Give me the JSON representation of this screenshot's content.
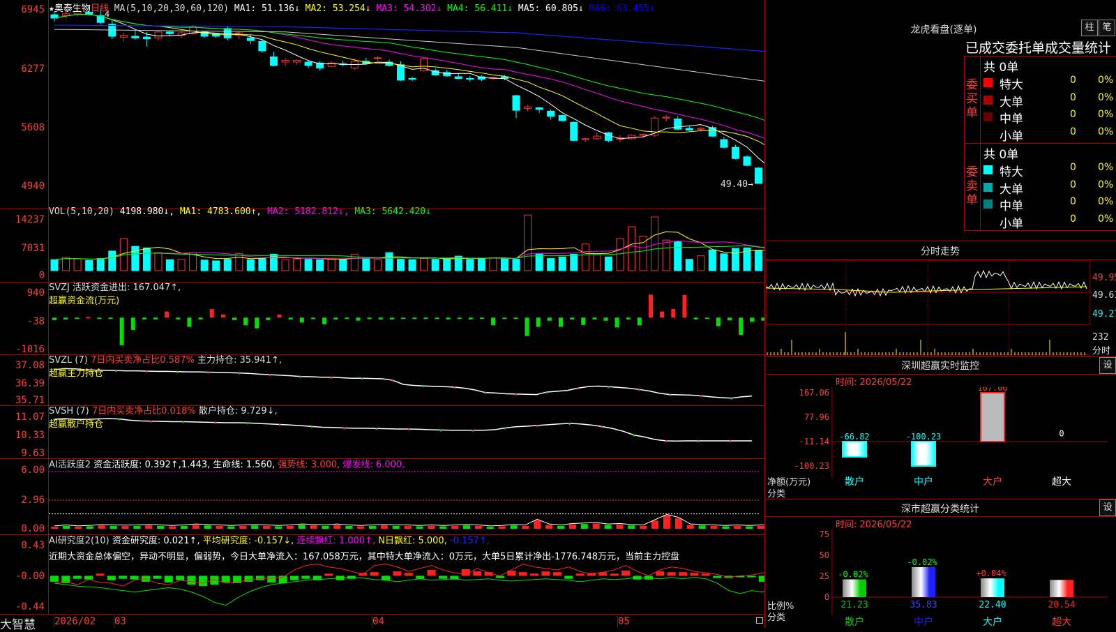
{
  "stock": {
    "name": "奥泰生物",
    "star": "★",
    "period": "日线"
  },
  "ma_line": {
    "label": "MA(5,10,20,30,60,120)",
    "items": [
      {
        "label": "MA1: 51.136↓",
        "color": "#ffffff"
      },
      {
        "label": "MA2: 53.254↓",
        "color": "#ffff00"
      },
      {
        "label": "MA3: 54.302↓",
        "color": "#ff00ff"
      },
      {
        "label": "MA4: 56.411↓",
        "color": "#00ff00"
      },
      {
        "label": "MA5: 60.805↓",
        "color": "#ffffff"
      },
      {
        "label": "MA6: 63.455↓",
        "color": "#0000ff"
      }
    ]
  },
  "price_axis": [
    "6945",
    "6277",
    "5608",
    "4940"
  ],
  "price_last_label": "49.40→",
  "price_top_marker": "4",
  "vol_line": {
    "label": "VOL(5,10,20)",
    "value": "4198.980↓,",
    "items": [
      {
        "label": "MA1: 4783.600↑,",
        "color": "#ffff00"
      },
      {
        "label": "MA2: 5182.812↓,",
        "color": "#ff00ff"
      },
      {
        "label": "MA3: 5642.420↓",
        "color": "#00ff00"
      }
    ]
  },
  "vol_axis": [
    "14237",
    "7031",
    "0"
  ],
  "svzj": {
    "line1": "SVZJ  活跃资金进出: 167.047↑,",
    "line2": "超赢资金流(万元)"
  },
  "svzj_axis": [
    "940",
    "-38",
    "-1016"
  ],
  "svzl": {
    "a": "SVZL (7)",
    "b": "7日内买卖净占比0.587%",
    "c": "主力持仓: 35.941↑,",
    "line2": "超赢主力持仓"
  },
  "svzl_axis": [
    "37.08",
    "36.39",
    "35.71"
  ],
  "svsh": {
    "a": "SVSH (7)",
    "b": "7日内买卖净占比0.018%",
    "c": "散户持仓: 9.729↓,",
    "line2": "超赢散户持仓"
  },
  "svsh_axis": [
    "11.07",
    "10.33",
    "9.63"
  ],
  "ai1": {
    "a": "AI活跃度2",
    "b": "资金活跃度: 0.392↑,1.443,",
    "c": "生命线: 1.560,",
    "d": "强势线: 3.000,",
    "e": "爆发线: 6.000,"
  },
  "ai1_axis": [
    "6.00",
    "2.96",
    "0.00"
  ],
  "ai2": {
    "a": "AI研究度2(10)",
    "b": "资金研究度: 0.021↑,",
    "c": "平均研究度: -0.157↓,",
    "d": "连续飘红: 1.000↑,",
    "e": "N日飘红: 5.000,",
    "f": "-0.157↑,"
  },
  "ai2_text": "近期大资金总体偏空，异动不明显，偏弱势，今日大单净流入：167.058万元，其中特大单净流入：0万元，大单5日累计净出-1776.748万元，当前主力控盘",
  "ai2_axis": [
    "0.43",
    "-0.00",
    "-0.44"
  ],
  "bottom": {
    "brand": "大智慧",
    "dates": [
      "2026/02",
      "03",
      "04",
      "05"
    ]
  },
  "dragon": {
    "title": "龙虎看盘(逐单)",
    "btn1": "柱",
    "btn2": "笔",
    "tabs": "已成交委托单成交量统计",
    "buy_label": "委买单",
    "sell_label": "委卖单",
    "buy_total": "共 0单",
    "sell_total": "共 0单",
    "buy_rows": [
      {
        "name": "特大",
        "count": "0",
        "pct": "0%",
        "color": "#ff0000"
      },
      {
        "name": "大单",
        "count": "0",
        "pct": "0%",
        "color": "#aa0000"
      },
      {
        "name": "中单",
        "count": "0",
        "pct": "0%",
        "color": "#660000"
      },
      {
        "name": "小单",
        "count": "0",
        "pct": "0%",
        "color": "#000000"
      }
    ],
    "sell_rows": [
      {
        "name": "特大",
        "count": "0",
        "pct": "0%",
        "color": "#00ffff"
      },
      {
        "name": "大单",
        "count": "0",
        "pct": "0%",
        "color": "#00aaaa"
      },
      {
        "name": "中单",
        "count": "0",
        "pct": "0%",
        "color": "#008080"
      },
      {
        "name": "小单",
        "count": "0",
        "pct": "0%",
        "color": "#000000"
      }
    ]
  },
  "intraday": {
    "title": "分时走势",
    "prices": [
      "49.95",
      "49.61",
      "49.27"
    ],
    "vol": "232",
    "vol_unit": "分时"
  },
  "monitor": {
    "title": "深圳超赢实时监控",
    "btn": "设",
    "time": "时间: 2026/05/22",
    "axis": [
      "167.06",
      "77.96",
      "-11.14",
      "-100.23"
    ],
    "ylabel": "净额(万元)",
    "xlabel": "分类",
    "bars": [
      {
        "cat": "散户",
        "value": -66.82,
        "label": "-66.82",
        "color": "#00ffff"
      },
      {
        "cat": "中户",
        "value": -100.23,
        "label": "-100.23",
        "color": "#00ffff"
      },
      {
        "cat": "大户",
        "value": 167.06,
        "label": "167.06",
        "color": "#ff2020"
      },
      {
        "cat": "超大",
        "value": 0,
        "label": "0",
        "color": "#ffffff"
      }
    ]
  },
  "classify": {
    "title": "深市超赢分类统计",
    "btn": "设",
    "time": "时间: 2026/05/22",
    "axis": [
      "75",
      "50",
      "25",
      "0"
    ],
    "ylabel": "比例%",
    "xlabel": "分类",
    "bars": [
      {
        "cat": "散户",
        "value": 21.23,
        "label": "21.23",
        "top": "-0.02%",
        "color": "#00cc00"
      },
      {
        "cat": "中户",
        "value": 35.83,
        "label": "35.83",
        "top": "-0.02%",
        "color": "#2020ff"
      },
      {
        "cat": "大户",
        "value": 22.4,
        "label": "22.40",
        "top": "+0.04%",
        "color": "#00ffff"
      },
      {
        "cat": "超大",
        "value": 20.54,
        "label": "20.54",
        "top": "",
        "color": "#ff2020"
      }
    ]
  },
  "chart_data": [
    {
      "type": "candlestick",
      "title": "奥泰生物 日线",
      "ylim": [
        49.0,
        69.9
      ],
      "ohlc": [
        [
          69.0,
          69.4,
          68.2,
          68.6
        ],
        [
          68.9,
          69.5,
          68.6,
          69.1
        ],
        [
          69.1,
          69.6,
          68.8,
          69.4
        ],
        [
          69.3,
          69.8,
          68.9,
          69.0
        ],
        [
          68.9,
          69.6,
          67.9,
          68.1
        ],
        [
          67.9,
          68.5,
          66.2,
          66.5
        ],
        [
          66.4,
          66.9,
          65.9,
          66.6
        ],
        [
          66.5,
          67.2,
          66.1,
          66.3
        ],
        [
          66.4,
          67.0,
          65.3,
          66.2
        ],
        [
          66.3,
          67.2,
          66.0,
          67.0
        ],
        [
          67.0,
          67.2,
          66.5,
          66.8
        ],
        [
          66.6,
          67.2,
          66.3,
          66.9
        ],
        [
          66.8,
          67.8,
          66.7,
          67.6
        ],
        [
          67.0,
          67.1,
          66.3,
          66.5
        ],
        [
          66.8,
          66.9,
          66.3,
          66.5
        ],
        [
          67.4,
          67.6,
          66.0,
          66.3
        ],
        [
          66.6,
          67.1,
          66.2,
          66.9
        ],
        [
          66.3,
          66.6,
          65.6,
          66.0
        ],
        [
          65.9,
          66.2,
          64.6,
          64.8
        ],
        [
          64.1,
          64.7,
          63.0,
          63.1
        ],
        [
          63.5,
          64.0,
          63.0,
          63.7
        ],
        [
          63.5,
          63.8,
          63.2,
          63.7
        ],
        [
          63.5,
          63.7,
          62.8,
          63.1
        ],
        [
          63.4,
          63.6,
          62.5,
          62.8
        ],
        [
          63.0,
          63.6,
          62.9,
          63.4
        ],
        [
          63.3,
          63.7,
          63.0,
          63.2
        ],
        [
          62.8,
          63.9,
          62.6,
          63.6
        ],
        [
          63.6,
          64.0,
          63.2,
          63.3
        ],
        [
          64.0,
          64.2,
          63.7,
          64.0
        ],
        [
          63.5,
          63.8,
          63.0,
          63.1
        ],
        [
          63.2,
          63.6,
          61.3,
          61.4
        ],
        [
          61.6,
          61.8,
          61.3,
          61.5
        ],
        [
          62.5,
          64.0,
          62.4,
          63.9
        ],
        [
          62.5,
          62.8,
          61.9,
          62.0
        ],
        [
          62.3,
          62.6,
          61.8,
          61.9
        ],
        [
          61.8,
          62.2,
          61.5,
          61.6
        ],
        [
          61.6,
          61.9,
          61.2,
          61.5
        ],
        [
          61.8,
          62.0,
          61.3,
          61.5
        ],
        [
          61.6,
          61.8,
          61.4,
          61.7
        ],
        [
          61.8,
          62.0,
          61.4,
          61.6
        ],
        [
          59.6,
          59.7,
          57.0,
          57.9
        ],
        [
          58.1,
          58.5,
          57.8,
          58.3
        ],
        [
          58.2,
          58.3,
          57.6,
          58.0
        ],
        [
          57.8,
          58.0,
          56.8,
          57.2
        ],
        [
          57.3,
          57.4,
          56.6,
          56.7
        ],
        [
          56.5,
          56.6,
          54.3,
          54.4
        ],
        [
          54.5,
          54.7,
          54.2,
          54.6
        ],
        [
          54.6,
          55.3,
          54.4,
          54.9
        ],
        [
          55.3,
          55.4,
          54.2,
          54.4
        ],
        [
          54.5,
          55.0,
          54.2,
          54.7
        ],
        [
          54.6,
          55.1,
          54.5,
          55.0
        ],
        [
          55.0,
          55.2,
          54.7,
          55.1
        ],
        [
          55.0,
          57.2,
          54.8,
          57.0
        ],
        [
          57.0,
          57.4,
          56.6,
          57.1
        ],
        [
          56.9,
          57.2,
          55.6,
          55.7
        ],
        [
          55.8,
          56.1,
          55.5,
          55.6
        ],
        [
          55.7,
          56.0,
          55.4,
          55.8
        ],
        [
          55.9,
          56.1,
          54.8,
          54.9
        ],
        [
          54.5,
          54.8,
          53.5,
          53.6
        ],
        [
          53.6,
          53.9,
          52.2,
          52.3
        ],
        [
          52.5,
          52.7,
          51.4,
          51.5
        ],
        [
          51.2,
          51.3,
          49.4,
          49.4
        ],
        [
          49.4,
          49.9,
          49.2,
          49.4
        ]
      ]
    },
    {
      "type": "bar",
      "title": "VOL(5,10,20)",
      "ylim": [
        0,
        14237
      ],
      "values": [
        2800,
        3400,
        3000,
        2600,
        3100,
        5000,
        8200,
        6200,
        5800,
        4600,
        2800,
        2900,
        4600,
        2700,
        2500,
        2900,
        4400,
        2800,
        3000,
        4200,
        2800,
        3000,
        2900,
        2800,
        3000,
        2900,
        4200,
        3000,
        2900,
        4600,
        2900,
        2800,
        3100,
        2900,
        3100,
        3700,
        2900,
        3100,
        3300,
        3200,
        2900,
        14200,
        4400,
        3100,
        3500,
        4200,
        6800,
        4100,
        3500,
        8200,
        11200,
        8800,
        13700,
        7800,
        7400,
        2900,
        3800,
        5300,
        4300,
        5700,
        5800,
        5200,
        4200
      ]
    },
    {
      "type": "bar",
      "title": "SVZJ 活跃资金进出",
      "ylim": [
        -1016,
        940
      ],
      "values": [
        -80,
        -60,
        -20,
        20,
        -40,
        -40,
        -900,
        -400,
        -60,
        -60,
        200,
        -60,
        -300,
        -60,
        280,
        100,
        -80,
        -250,
        -350,
        -80,
        100,
        -60,
        -160,
        -50,
        -220,
        -60,
        -30,
        -100,
        -50,
        -60,
        -60,
        -40,
        -30,
        -30,
        -20,
        -60,
        -40,
        -60,
        -40,
        -250,
        -30,
        -30,
        -600,
        -300,
        -100,
        -300,
        -60,
        -240,
        -60,
        -100,
        -320,
        -60,
        -250,
        750,
        200,
        280,
        740,
        -60,
        -40,
        -280,
        -90,
        -560,
        -140,
        -100,
        -560,
        150
      ]
    },
    {
      "type": "line",
      "title": "SVZL 主力持仓",
      "ylim": [
        35.71,
        37.08
      ],
      "values": [
        36.92,
        36.96,
        36.95,
        36.92,
        36.9,
        36.89,
        36.88,
        36.87,
        36.87,
        36.86,
        36.85,
        36.85,
        36.84,
        36.83,
        36.83,
        36.82,
        36.81,
        36.8,
        36.79,
        36.77,
        36.74,
        36.72,
        36.7,
        36.68,
        36.65,
        36.64,
        36.62,
        36.62,
        36.6,
        36.58,
        36.58,
        36.57,
        36.56,
        36.5,
        36.34,
        36.3,
        36.28,
        36.26,
        36.25,
        36.23,
        36.19,
        36.12,
        36.02,
        36.0,
        35.97,
        35.96,
        35.95,
        35.94,
        36.04,
        36.07,
        36.1,
        36.19,
        36.25,
        36.27,
        36.25,
        36.22,
        36.19,
        36.14,
        36.08,
        35.99,
        35.94,
        35.93,
        35.92,
        35.89,
        35.85,
        35.82,
        35.8,
        35.85,
        35.88
      ]
    },
    {
      "type": "line",
      "title": "SVSH 散户持仓",
      "ylim": [
        9.63,
        11.07
      ],
      "values": [
        10.99,
        11.01,
        10.98,
        10.98,
        11.0,
        11.01,
        11.0,
        10.95,
        10.92,
        10.91,
        10.9,
        10.89,
        10.89,
        10.88,
        10.87,
        10.86,
        10.85,
        10.85,
        10.84,
        10.82,
        10.8,
        10.78,
        10.76,
        10.73,
        10.7,
        10.67,
        10.66,
        10.64,
        10.63,
        10.63,
        10.62,
        10.61,
        10.6,
        10.6,
        10.59,
        10.57,
        10.56,
        10.55,
        10.55,
        10.55,
        10.55,
        10.57,
        10.64,
        10.69,
        10.71,
        10.74,
        10.77,
        10.8,
        10.82,
        10.8,
        10.76,
        10.7,
        10.62,
        10.51,
        10.36,
        10.28,
        10.18,
        10.13,
        10.12,
        10.13,
        10.13,
        10.13,
        10.13,
        10.13,
        10.13,
        10.13
      ]
    },
    {
      "type": "bar",
      "title": "AI活跃度2",
      "ylim": [
        0,
        6.0
      ],
      "values": [
        0.2,
        0.3,
        0.2,
        0.25,
        0.35,
        0.3,
        0.28,
        0.3,
        0.35,
        0.3,
        0.25,
        0.3,
        0.4,
        0.35,
        0.3,
        0.25,
        0.3,
        0.35,
        0.3,
        0.25,
        0.3,
        0.4,
        0.35,
        0.3,
        0.4,
        0.3,
        0.25,
        0.3,
        0.35,
        0.3,
        0.3,
        0.25,
        0.3,
        0.25,
        0.3,
        0.35,
        0.3,
        0.2,
        0.25,
        0.35,
        0.3,
        0.9,
        0.4,
        0.3,
        0.45,
        0.5,
        0.55,
        0.4,
        0.45,
        0.35,
        0.3,
        0.85,
        1.4,
        1.1,
        0.4,
        0.35,
        0.3,
        0.25,
        0.3,
        0.25,
        0.3,
        0.3,
        0.3,
        0.3,
        0.39
      ]
    },
    {
      "type": "bar",
      "title": "AI研究度2(10)",
      "ylim": [
        -0.44,
        0.43
      ],
      "values": [
        -0.08,
        -0.1,
        -0.04,
        -0.05,
        0.03,
        -0.06,
        -0.04,
        -0.05,
        -0.08,
        -0.04,
        -0.09,
        -0.06,
        -0.12,
        -0.14,
        -0.12,
        -0.09,
        -0.1,
        -0.08,
        -0.06,
        -0.09,
        -0.1,
        -0.06,
        -0.04,
        -0.06,
        0.03,
        -0.06,
        -0.04,
        0.04,
        0.05,
        -0.06,
        0.06,
        0.04,
        -0.04,
        0.08,
        -0.04,
        -0.05,
        0.09,
        0.06,
        0.05,
        -0.03,
        0.07,
        0.05,
        0.03,
        0.06,
        0.05,
        -0.04,
        0.03,
        0.04,
        0.05,
        0.03,
        0.07,
        -0.05,
        -0.05,
        0.06,
        0.05,
        0.05,
        0.04,
        0.03,
        -0.03,
        -0.03,
        -0.02,
        -0.02,
        -0.08,
        -0.06,
        -0.04,
        0.02
      ]
    }
  ]
}
